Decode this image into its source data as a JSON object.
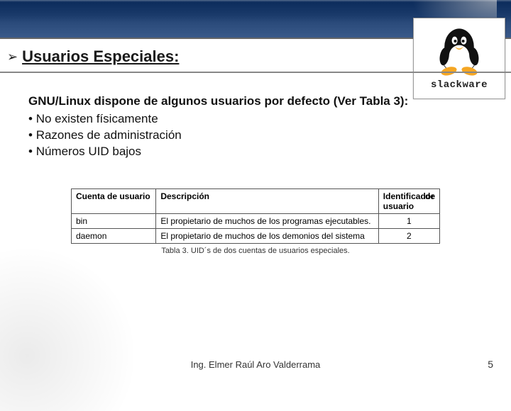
{
  "heading": "Usuarios Especiales:",
  "logo_label": "slackware",
  "intro": "GNU/Linux dispone de algunos usuarios por defecto (Ver Tabla 3):",
  "bullets": [
    "No existen físicamente",
    "Razones de administración",
    "Números UID bajos"
  ],
  "table": {
    "headers": {
      "col1": "Cuenta de usuario",
      "col2": "Descripción",
      "col3_main": "Identificador",
      "col3_sub": "usuario",
      "col3_right": "de"
    },
    "rows": [
      {
        "account": "bin",
        "desc": "El propietario de muchos de los programas ejecutables.",
        "uid": "1"
      },
      {
        "account": "daemon",
        "desc": "El propietario de muchos de los demonios del sistema",
        "uid": "2"
      }
    ],
    "caption": "Tabla 3. UID´s de dos cuentas de usuarios especiales."
  },
  "footer": {
    "author": "Ing. Elmer Raúl Aro Valderrama",
    "page": "5"
  }
}
